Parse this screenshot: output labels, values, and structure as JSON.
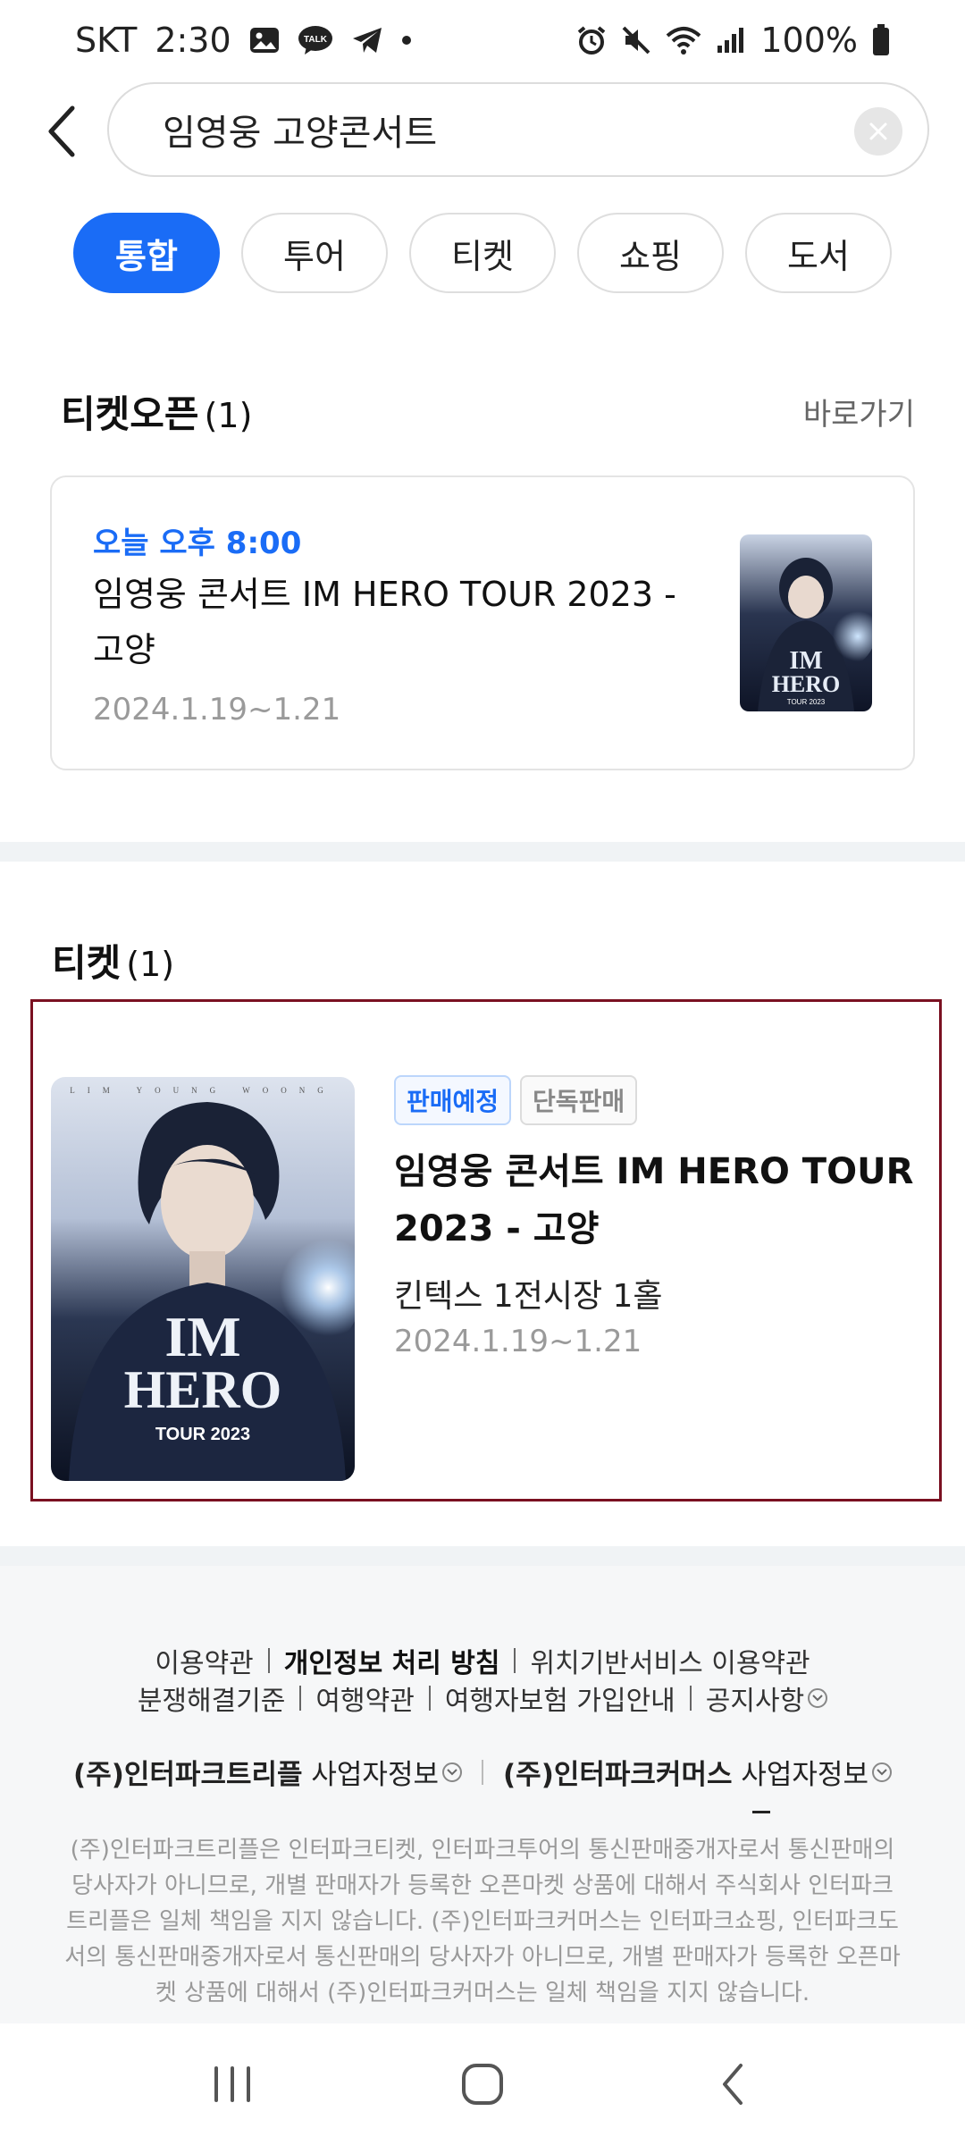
{
  "status_bar": {
    "carrier": "SKT",
    "time": "2:30",
    "battery": "100%"
  },
  "search": {
    "query": "임영웅 고양콘서트"
  },
  "tabs": [
    {
      "label": "통합",
      "active": true
    },
    {
      "label": "투어",
      "active": false
    },
    {
      "label": "티켓",
      "active": false
    },
    {
      "label": "쇼핑",
      "active": false
    },
    {
      "label": "도서",
      "active": false
    }
  ],
  "ticket_open": {
    "title": "티켓오픈",
    "count": "(1)",
    "shortcut_label": "바로가기",
    "item": {
      "time": "오늘 오후 8:00",
      "title": "임영웅 콘서트 IM HERO TOUR 2023 - 고양",
      "date": "2024.1.19~1.21"
    }
  },
  "tickets": {
    "title": "티켓",
    "count": "(1)",
    "item": {
      "badges": [
        "판매예정",
        "단독판매"
      ],
      "title": "임영웅 콘서트 IM HERO TOUR 2023 - 고양",
      "venue": "킨텍스 1전시장 1홀",
      "date": "2024.1.19~1.21",
      "poster_text": {
        "artist": "LIM YOUNG WOONG",
        "logo_line1": "IM",
        "logo_line2": "HERO",
        "tour": "TOUR 2023"
      }
    }
  },
  "footer": {
    "row1": [
      "이용약관",
      "개인정보 처리 방침",
      "위치기반서비스 이용약관"
    ],
    "row2": [
      "분쟁해결기준",
      "여행약관",
      "여행자보험 가입안내",
      "공지사항"
    ],
    "company1_name": "(주)인터파크트리플",
    "company1_suffix": "사업자정보",
    "company2_name": "(주)인터파크커머스",
    "company2_suffix": "사업자정보",
    "disclaimer": "(주)인터파크트리플은 인터파크티켓, 인터파크투어의 통신판매중개자로서 통신판매의 당사자가 아니므로, 개별 판매자가 등록한 오픈마켓 상품에 대해서 주식회사 인터파크트리플은 일체 책임을 지지 않습니다. (주)인터파크커머스는 인터파크쇼핑, 인터파크도서의 통신판매중개자로서 통신판매의 당사자가 아니므로, 개별 판매자가 등록한 오픈마켓 상품에 대해서 (주)인터파크커머스는 일체 책임을 지지 않습니다."
  },
  "colors": {
    "accent": "#1a6cf6",
    "highlight_border": "#7a1021"
  }
}
